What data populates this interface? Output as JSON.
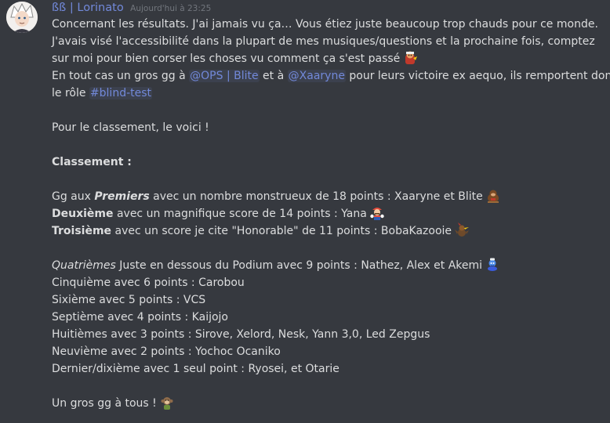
{
  "message": {
    "author": "ßß | Lorinato",
    "timestamp": "Aujourd'hui à 23:25",
    "lines": {
      "l1": "Concernant les résultats. J'ai jamais vu ça… Vous étiez juste beaucoup trop chauds pour ce monde.",
      "l2": "J'avais visé l'accessibilité dans la plupart de mes musiques/questions et la prochaine fois, comptez",
      "l3": "sur moi pour bien corser les choses vu comment ça s'est passé",
      "l4_a": "En tout cas un gros gg à ",
      "l4_mention1": "@OPS | Blite",
      "l4_b": " et à ",
      "l4_mention2": "@Xaaryne",
      "l4_c": " pour leurs victoire ex aequo, ils remportent donc",
      "l5_a": "le rôle ",
      "l5_channel": "#blind-test",
      "l6": "Pour le classement, le voici !",
      "l7": "Classement :",
      "l8_a": "Gg aux ",
      "l8_bold": "Premiers",
      "l8_b": " avec un nombre monstrueux de 18 points : Xaaryne et Blite",
      "l9_bold": "Deuxième",
      "l9_b": " avec un magnifique score de 14 points : Yana",
      "l10_bold": "Troisième",
      "l10_b": " avec un score je cite \"Honorable\" de 11 points : BobaKazooie",
      "l11_italic": "Quatrièmes",
      "l11_b": " Juste en dessous du Podium avec 9 points : Nathez, Alex et Akemi",
      "l12": "Cinquième avec 6 points : Carobou",
      "l13": "Sixième avec 5 points : VCS",
      "l14": "Septième avec 4 points : Kaijojo",
      "l15": "Huitièmes avec 3 points : Sirove, Xelord, Nesk, Yann 3,0, Led Zepgus",
      "l16": "Neuvième avec 2 points : Yochoc Ocaniko",
      "l17": "Dernier/dixième avec 1 seul point : Ryosei, et Otarie",
      "l18": "Un gros gg à tous !"
    },
    "emojis": {
      "l3": "banjo-kazooie-emoji",
      "l8": "donkey-kong-emoji",
      "l9": "mario-emoji",
      "l10": "kazooie-emoji",
      "l11": "genie-emoji",
      "l18": "monkey-emoji"
    }
  },
  "colors": {
    "background": "#36393f",
    "text": "#dcddde",
    "username": "#7289da",
    "mention": "#7289da",
    "timestamp": "#72767d"
  }
}
